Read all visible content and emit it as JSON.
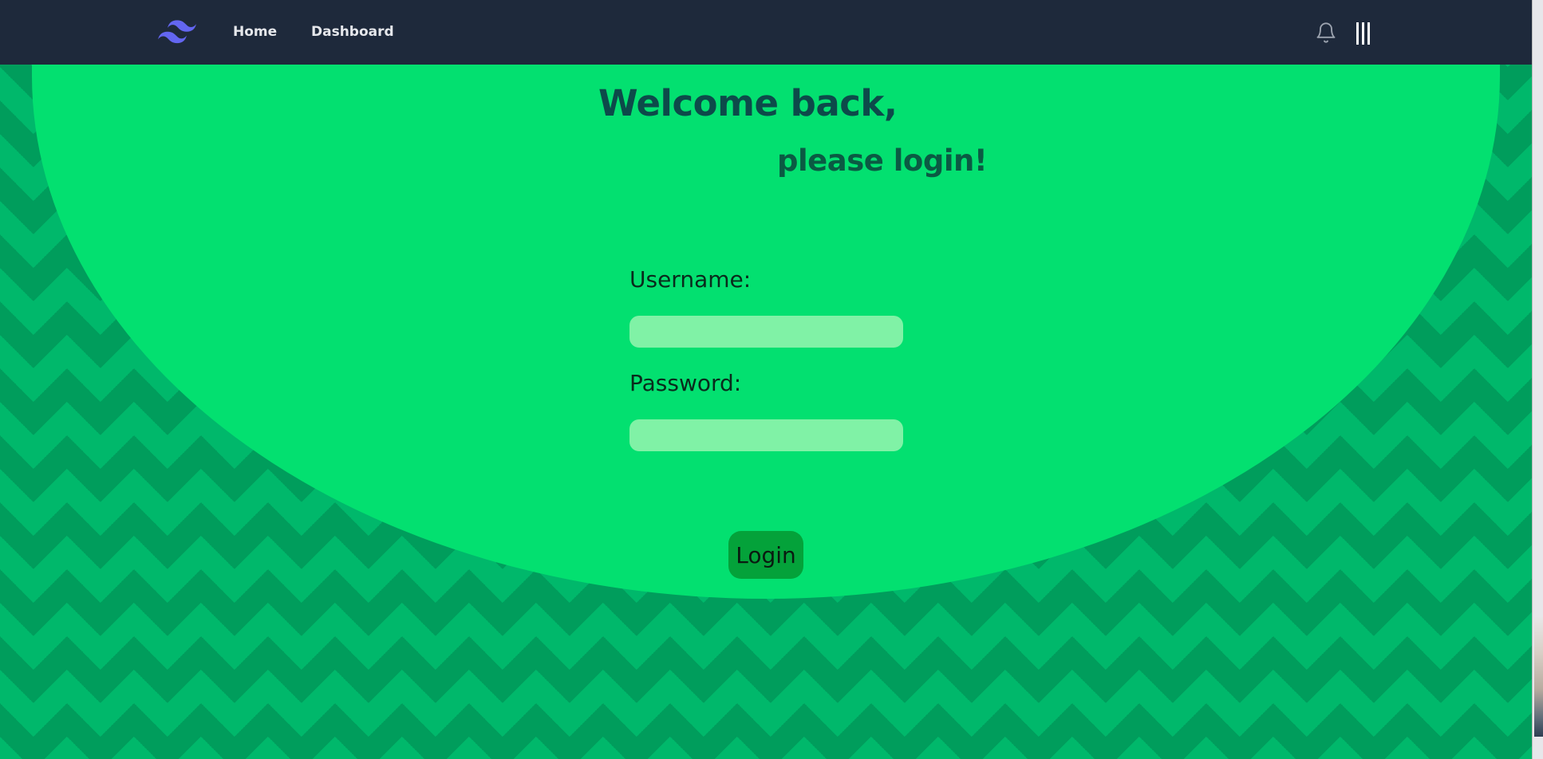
{
  "nav": {
    "links": [
      {
        "label": "Home"
      },
      {
        "label": "Dashboard"
      }
    ]
  },
  "colors": {
    "navbar": "#1e293b",
    "hero": "#03e070",
    "pattern_light": "#00b86b",
    "pattern_dark": "#009d5c",
    "input_bg": "#80f2a6",
    "button_bg": "#04a23a",
    "logo": "#6366f1"
  },
  "icons": {
    "logo": "tailwind-logo-icon",
    "notifications": "bell-icon",
    "menu": "menu-bars-icon"
  },
  "hero": {
    "heading": "Welcome back,",
    "subheading": "please login!"
  },
  "form": {
    "username_label": "Username:",
    "username_value": "",
    "password_label": "Password:",
    "password_value": "",
    "submit_label": "Login"
  }
}
